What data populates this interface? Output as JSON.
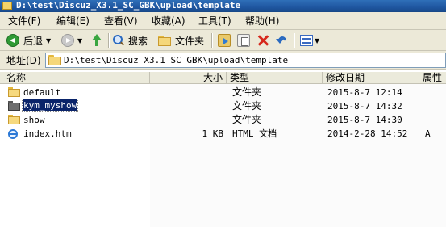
{
  "window": {
    "title": "D:\\test\\Discuz_X3.1_SC_GBK\\upload\\template"
  },
  "menu": [
    "文件(F)",
    "编辑(E)",
    "查看(V)",
    "收藏(A)",
    "工具(T)",
    "帮助(H)"
  ],
  "toolbar": {
    "back_label": "后退",
    "search_label": "搜索",
    "folders_label": "文件夹",
    "icons": [
      "back-icon",
      "forward-icon",
      "up-folder-icon",
      "search-icon",
      "folders-icon",
      "move-to-icon",
      "copy-to-icon",
      "delete-icon",
      "undo-icon",
      "views-icon"
    ]
  },
  "address": {
    "label": "地址(D)",
    "value": "D:\\test\\Discuz_X3.1_SC_GBK\\upload\\template"
  },
  "columns": {
    "name": "名称",
    "size": "大小",
    "type": "类型",
    "modified": "修改日期",
    "attributes": "属性"
  },
  "files": [
    {
      "name": "default",
      "size": "",
      "type": "文件夹",
      "modified": "2015-8-7 12:14",
      "attributes": "",
      "icon": "folder-icon",
      "selected": false
    },
    {
      "name": "kym_myshow",
      "size": "",
      "type": "文件夹",
      "modified": "2015-8-7 14:32",
      "attributes": "",
      "icon": "folder-icon",
      "selected": true
    },
    {
      "name": "show",
      "size": "",
      "type": "文件夹",
      "modified": "2015-8-7 14:30",
      "attributes": "",
      "icon": "folder-icon",
      "selected": false
    },
    {
      "name": "index.htm",
      "size": "1 KB",
      "type": "HTML 文档",
      "modified": "2014-2-28 14:52",
      "attributes": "A",
      "icon": "html-document-icon",
      "selected": false
    }
  ],
  "colors": {
    "titlebar": "#1f56a0",
    "chrome": "#ece9d8",
    "selection": "#0a246a"
  }
}
